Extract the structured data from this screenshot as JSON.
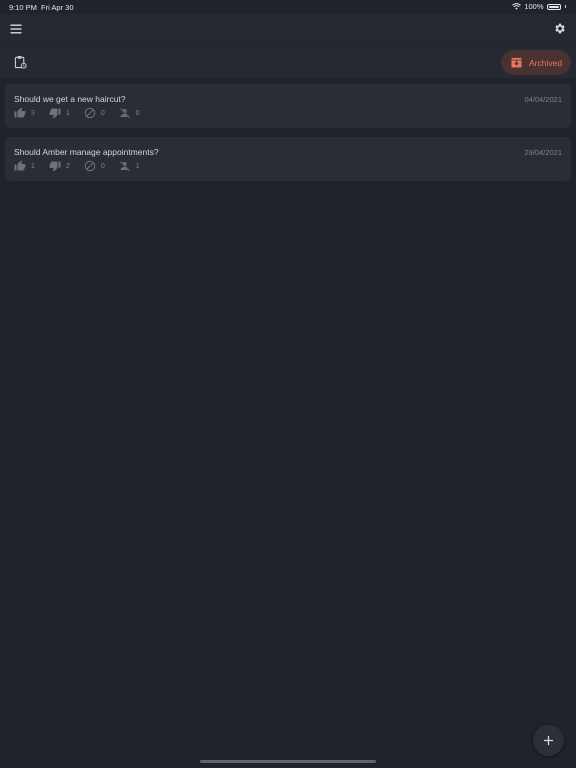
{
  "status_bar": {
    "time": "9:10 PM",
    "date": "Fri Apr 30",
    "battery": "100%",
    "battery_level": 1.0
  },
  "app_bar": {
    "menu_icon": "hamburger-menu-icon",
    "settings_icon": "gear-icon"
  },
  "toolbar": {
    "clipboard_icon": "clipboard-icon",
    "archived_label": "Archived",
    "archived_icon": "archive-box-icon"
  },
  "polls": [
    {
      "title": "Should we get a new haircut?",
      "date": "04/04/2021",
      "counts": {
        "yes": "3",
        "no": "1",
        "abstain": "0",
        "absent": "0"
      }
    },
    {
      "title": "Should Amber manage appointments?",
      "date": "29/04/2021",
      "counts": {
        "yes": "1",
        "no": "2",
        "abstain": "0",
        "absent": "1"
      }
    }
  ],
  "fab": {
    "icon": "plus-icon"
  },
  "colors": {
    "background": "#21232b",
    "card": "#2a2d35",
    "accent": "#e8775c",
    "muted": "#7e828c"
  }
}
